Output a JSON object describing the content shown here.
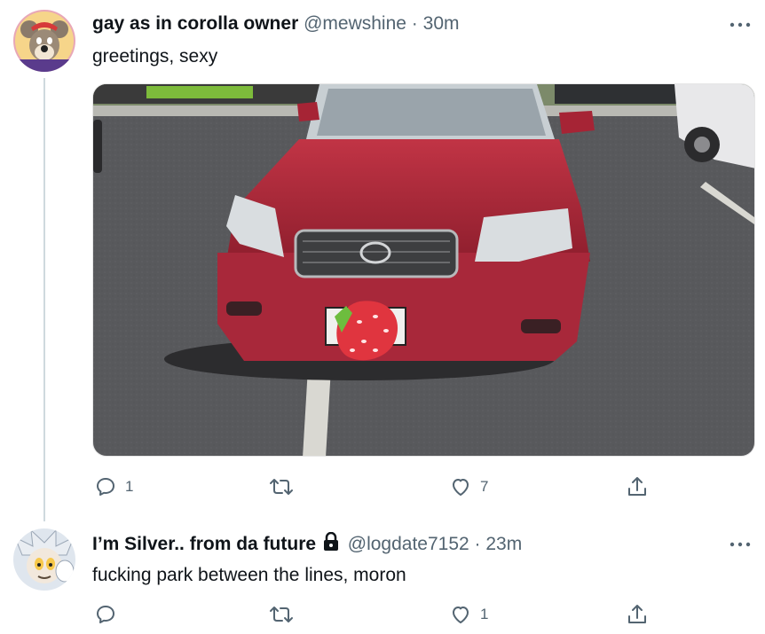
{
  "tweets": [
    {
      "display_name": "gay as in corolla owner",
      "handle": "@mewshine",
      "separator": "·",
      "time": "30m",
      "text": "greetings, sexy",
      "more_icon": "ellipsis-icon",
      "actions": {
        "reply_count": "1",
        "retweet_count": "",
        "like_count": "7"
      }
    },
    {
      "display_name": "I’m Silver.. from da future",
      "handle": "@logdate7152",
      "separator": "·",
      "time": "23m",
      "text": "fucking park between the lines, moron",
      "protected": true,
      "more_icon": "ellipsis-icon",
      "actions": {
        "reply_count": "",
        "retweet_count": "",
        "like_count": "1"
      }
    }
  ],
  "colors": {
    "secondary_text": "#536471",
    "thread_line": "#cfd9de",
    "car_red": "#b3283a"
  }
}
